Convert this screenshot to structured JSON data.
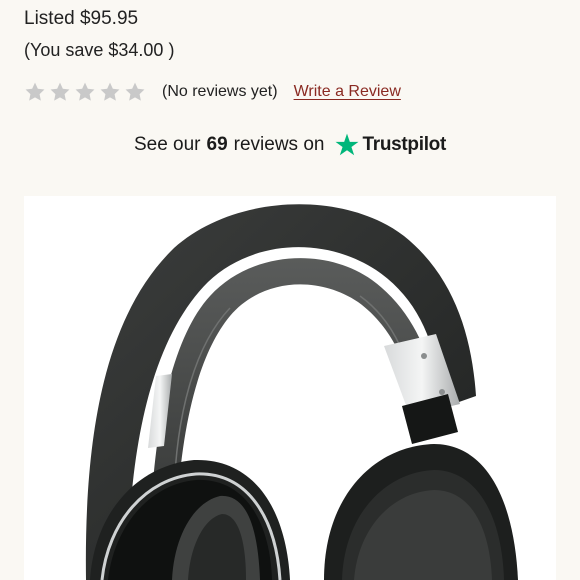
{
  "price": {
    "listed": "Listed $95.95",
    "savings": "(You save $34.00 )"
  },
  "rating": {
    "star_count": 5,
    "filled_stars": 0,
    "star_color": "#c9c9c9",
    "no_reviews": "(No reviews yet)",
    "write_review": "Write a Review",
    "link_color": "#8a2a22"
  },
  "trustpilot": {
    "prefix": "See our",
    "count": "69",
    "suffix": "reviews on",
    "brand": "Trustpilot",
    "brand_color": "#00b67a"
  },
  "product": {
    "image_icon": "headphones-image"
  }
}
